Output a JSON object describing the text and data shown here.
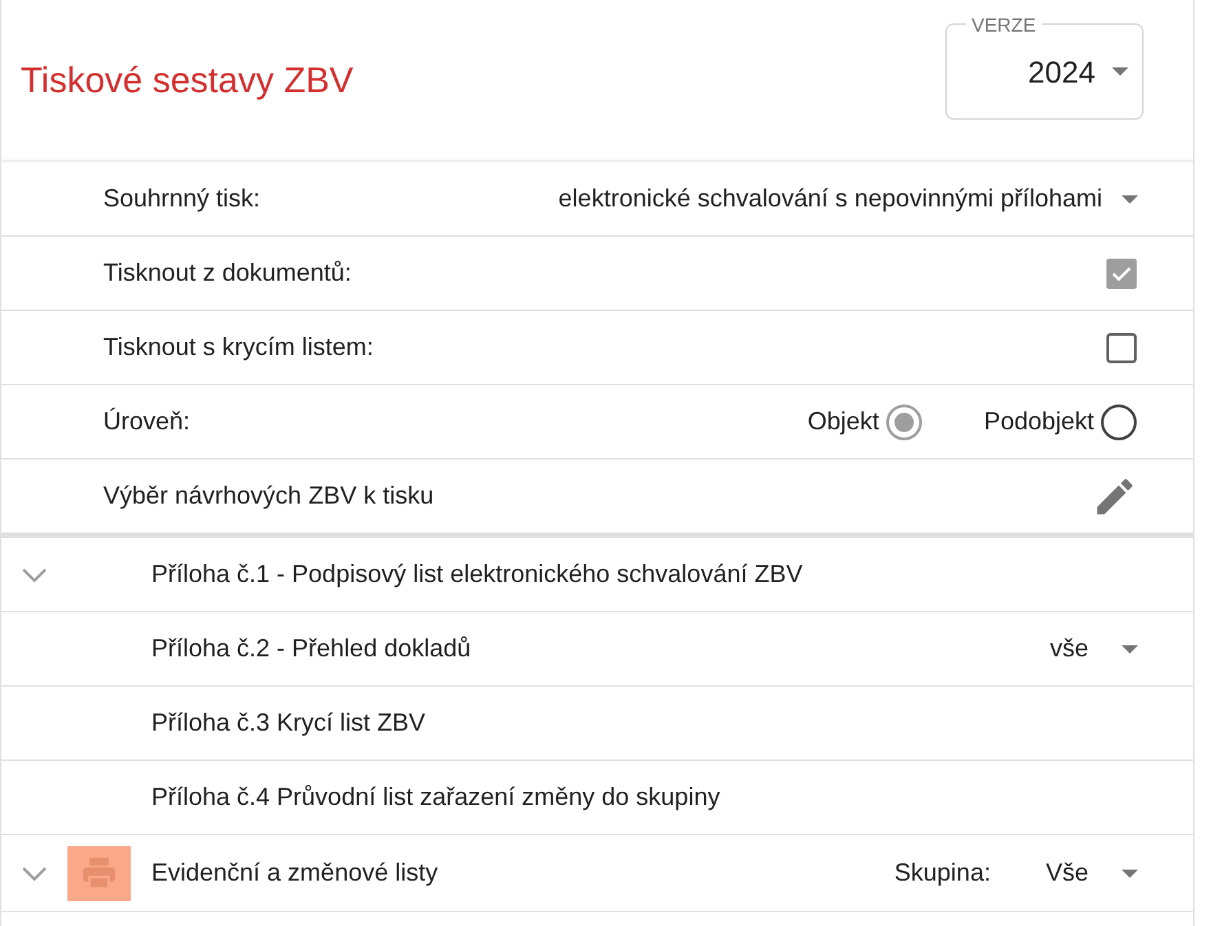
{
  "title": "Tiskové sestavy ZBV",
  "version": {
    "label": "VERZE",
    "value": "2024"
  },
  "settings": [
    {
      "kind": "select",
      "label": "Souhrnný tisk:",
      "value": "elektronické schvalování s nepovinnými přílohami"
    },
    {
      "kind": "checkbox",
      "label": "Tisknout z dokumentů:",
      "checked": true
    },
    {
      "kind": "checkbox",
      "label": "Tisknout s krycím listem:",
      "checked": false
    },
    {
      "kind": "radio",
      "label": "Úroveň:",
      "options": [
        {
          "label": "Objekt",
          "selected": true
        },
        {
          "label": "Podobjekt",
          "selected": false
        }
      ]
    },
    {
      "kind": "edit",
      "label": "Výběr návrhových ZBV k tisku"
    }
  ],
  "attachments": {
    "expanded": true,
    "items": [
      {
        "label": "Příloha č.1 - Podpisový list elektronického schvalování ZBV"
      },
      {
        "label": "Příloha č.2 - Přehled dokladů",
        "value": "vše"
      },
      {
        "label": "Příloha č.3 Krycí list ZBV"
      },
      {
        "label": "Příloha č.4 Průvodní list zařazení změny do skupiny"
      }
    ]
  },
  "section": {
    "expanded": true,
    "label": "Evidenční a změnové listy",
    "group_label": "Skupina:",
    "group_value": "Vše"
  }
}
